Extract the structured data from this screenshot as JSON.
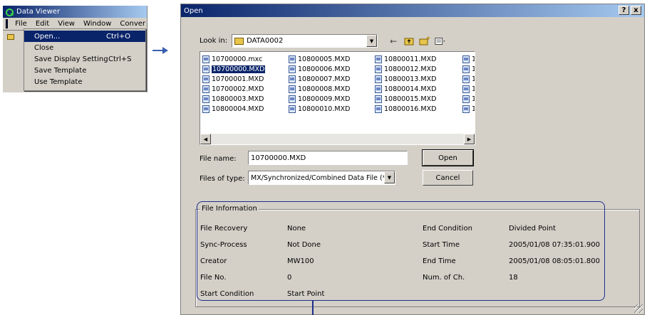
{
  "data_viewer": {
    "title": "Data Viewer",
    "menubar": [
      "File",
      "Edit",
      "View",
      "Window",
      "Conver"
    ],
    "file_menu": [
      {
        "label": "Open...",
        "shortcut": "Ctrl+O",
        "selected": true
      },
      {
        "label": "Close",
        "shortcut": ""
      },
      {
        "label": "Save Display Setting",
        "shortcut": "Ctrl+S"
      },
      {
        "label": "Save Template",
        "shortcut": ""
      },
      {
        "label": "Use Template",
        "shortcut": ""
      }
    ]
  },
  "dialog": {
    "title": "Open",
    "help_button": "?",
    "close_button": "x",
    "look_in_label": "Look in:",
    "look_in_value": "DATA0002",
    "files": [
      [
        "10700000.mxc",
        "10700000.MXD",
        "10700001.MXD",
        "10700002.MXD",
        "10800003.MXD",
        "10800004.MXD"
      ],
      [
        "10800005.MXD",
        "10800006.MXD",
        "10800007.MXD",
        "10800008.MXD",
        "10800009.MXD",
        "10800010.MXD"
      ],
      [
        "10800011.MXD",
        "10800012.MXD",
        "10800013.MXD",
        "10800014.MXD",
        "10800015.MXD",
        "10800016.MXD"
      ],
      [
        "1",
        "1",
        "1",
        "1",
        "1",
        "1"
      ]
    ],
    "selected_file": "10700000.MXD",
    "file_name_label": "File name:",
    "file_name_value": "10700000.MXD",
    "files_of_type_label": "Files of type:",
    "files_of_type_value": "MX/Synchronized/Combined Data File (*.mxd",
    "open_button": "Open",
    "cancel_button": "Cancel",
    "file_info": {
      "legend": "File Information",
      "left": [
        {
          "label": "File Recovery",
          "value": "None"
        },
        {
          "label": "Sync-Process",
          "value": "Not Done"
        },
        {
          "label": "Creator",
          "value": "MW100"
        },
        {
          "label": "File No.",
          "value": "0"
        },
        {
          "label": "Start Condition",
          "value": "Start Point"
        }
      ],
      "right": [
        {
          "label": "End Condition",
          "value": "Divided Point"
        },
        {
          "label": "Start Time",
          "value": "2005/01/08 07:35:01.900"
        },
        {
          "label": "End Time",
          "value": "2005/01/08 08:05:01.800"
        },
        {
          "label": "Num. of Ch.",
          "value": "18"
        }
      ]
    }
  },
  "colors": {
    "titlebar": "#0a246a",
    "selection": "#0a246a",
    "callout": "#1d2f8c",
    "arrow": "#3a5fb0"
  }
}
